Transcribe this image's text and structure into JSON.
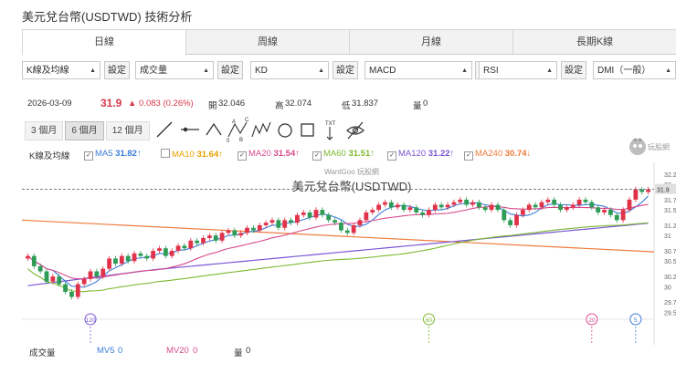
{
  "page_title": "美元兌台幣(USDTWD) 技術分析",
  "tabs": [
    {
      "label": "日線",
      "active": true
    },
    {
      "label": "周線",
      "active": false
    },
    {
      "label": "月線",
      "active": false
    },
    {
      "label": "長期K線",
      "active": false
    }
  ],
  "selectors": [
    {
      "value": "K線及均線",
      "button": "設定"
    },
    {
      "value": "成交量",
      "button": "設定"
    },
    {
      "value": "KD",
      "button": "設定"
    },
    {
      "value": "MACD",
      "button": "設定"
    },
    {
      "value": "RSI",
      "button": "設定"
    },
    {
      "value": "DMI（一般）",
      "button": "設定"
    }
  ],
  "quote": {
    "date": "2026-03-09",
    "price": "31.9",
    "change": "▲ 0.083 (0.26%)",
    "open_label": "開",
    "open": "32.046",
    "high_label": "高",
    "high": "32.074",
    "low_label": "低",
    "low": "31.837",
    "vol_label": "量",
    "vol": "0"
  },
  "periods": [
    {
      "label": "3 個月",
      "active": false
    },
    {
      "label": "6 個月",
      "active": true
    },
    {
      "label": "12 個月",
      "active": false
    }
  ],
  "tools": [
    "line-tool-icon",
    "horizontal-line-tool-icon",
    "trend-tool-icon",
    "abc-pattern-tool-icon",
    "abcde-pattern-tool-icon",
    "circle-tool-icon",
    "rectangle-tool-icon",
    "text-tool-icon",
    "hide-drawings-icon"
  ],
  "indicator_bar": {
    "label": "K線及均線",
    "items": [
      {
        "name": "MA5",
        "value": "31.82",
        "arrow": "↑",
        "checked": true,
        "color": "#3b7dd8"
      },
      {
        "name": "MA10",
        "value": "31.64",
        "arrow": "↑",
        "checked": false,
        "color": "#e6a100"
      },
      {
        "name": "MA20",
        "value": "31.54",
        "arrow": "↑",
        "checked": true,
        "color": "#d94a8c"
      },
      {
        "name": "MA60",
        "value": "31.51",
        "arrow": "↑",
        "checked": true,
        "color": "#7cb82f"
      },
      {
        "name": "MA120",
        "value": "31.22",
        "arrow": "↑",
        "checked": true,
        "color": "#7a55d4"
      },
      {
        "name": "MA240",
        "value": "30.74",
        "arrow": "↓",
        "checked": true,
        "color": "#ee7a3a"
      }
    ]
  },
  "chart_data": {
    "type": "candlestick",
    "watermark": "WantGoo 玩股網",
    "title": "美元兌台幣(USDTWD)",
    "y_ticks": [
      "32.2",
      "32",
      "31.7",
      "31.5",
      "31.2",
      "31",
      "30.7",
      "30.5",
      "30.2",
      "30",
      "29.7",
      "29.5"
    ],
    "last_price_tag": "31.9",
    "ylim": [
      29.4,
      32.25
    ],
    "closes": [
      30.6,
      30.4,
      30.3,
      30.1,
      30.2,
      30.05,
      29.9,
      29.8,
      30.05,
      30.15,
      30.3,
      30.2,
      30.35,
      30.55,
      30.45,
      30.6,
      30.5,
      30.65,
      30.6,
      30.55,
      30.7,
      30.75,
      30.6,
      30.7,
      30.8,
      30.75,
      30.9,
      30.85,
      30.95,
      31.0,
      30.9,
      31.05,
      31.1,
      31.0,
      31.05,
      31.15,
      31.1,
      31.2,
      31.25,
      31.3,
      31.15,
      31.3,
      31.25,
      31.4,
      31.45,
      31.35,
      31.5,
      31.4,
      31.3,
      31.25,
      31.1,
      31.05,
      31.2,
      31.3,
      31.45,
      31.5,
      31.6,
      31.65,
      31.55,
      31.6,
      31.5,
      31.55,
      31.45,
      31.4,
      31.5,
      31.6,
      31.55,
      31.6,
      31.65,
      31.7,
      31.6,
      31.65,
      31.55,
      31.5,
      31.6,
      31.5,
      31.3,
      31.2,
      31.4,
      31.5,
      31.6,
      31.55,
      31.65,
      31.7,
      31.6,
      31.5,
      31.55,
      31.6,
      31.7,
      31.65,
      31.55,
      31.45,
      31.5,
      31.4,
      31.3,
      31.5,
      31.7,
      31.9,
      31.85,
      31.9
    ],
    "event_markers": [
      {
        "label": "120",
        "index": 10,
        "color": "#7a55d4"
      },
      {
        "label": "60",
        "index": 64,
        "color": "#7cb82f"
      },
      {
        "label": "20",
        "index": 90,
        "color": "#d94a8c"
      },
      {
        "label": "5",
        "index": 97,
        "color": "#3b7dd8"
      }
    ]
  },
  "volume_bar": {
    "label": "成交量",
    "items": [
      {
        "name": "MV5",
        "value": "0",
        "color": "#3b7dd8"
      },
      {
        "name": "MV20",
        "value": "0",
        "color": "#d94a8c"
      },
      {
        "name": "量",
        "value": "0",
        "color": "#333333"
      }
    ]
  },
  "colors": {
    "up": "#e0334a",
    "down": "#2e9b57",
    "accent": "#d9394a"
  }
}
